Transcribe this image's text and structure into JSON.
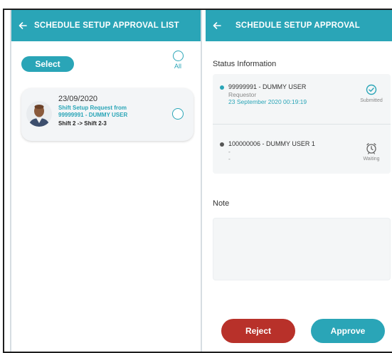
{
  "left_screen": {
    "header": {
      "title": "SCHEDULE SETUP APPROVAL LIST"
    },
    "select_label": "Select",
    "all_label": "All",
    "request_card": {
      "date": "23/09/2020",
      "line1": "Shift Setup Request from",
      "line2": "99999991 - DUMMY USER",
      "shift": "Shift 2 -> Shift 2-3"
    }
  },
  "right_screen": {
    "header": {
      "title": "SCHEDULE SETUP APPROVAL"
    },
    "status_section_title": "Status Information",
    "status_rows": [
      {
        "name": "99999991 - DUMMY USER",
        "role": "Requestor",
        "time": "23 September 2020 00:19:19",
        "status": "Submitted",
        "icon": "check-circle-icon"
      },
      {
        "name": "100000006 - DUMMY USER 1",
        "role": "-",
        "time": "-",
        "status": "Waiting",
        "icon": "alarm-clock-icon"
      }
    ],
    "note_title": "Note",
    "note_value": "",
    "reject_label": "Reject",
    "approve_label": "Approve"
  },
  "colors": {
    "accent": "#2aa5b7",
    "reject": "#b8312a",
    "panel": "#f4f6f7"
  }
}
